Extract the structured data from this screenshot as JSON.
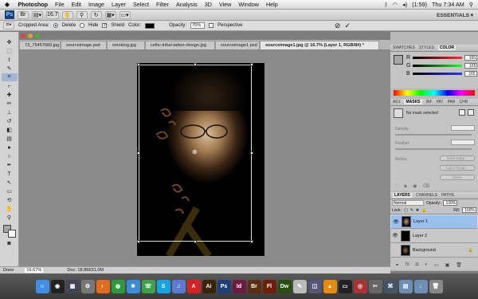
{
  "menubar": {
    "apple": "",
    "app_name": "Photoshop",
    "items": [
      "File",
      "Edit",
      "Image",
      "Layer",
      "Select",
      "Filter",
      "Analysis",
      "3D",
      "View",
      "Window",
      "Help"
    ],
    "battery": "(1:59)",
    "clock": "Thu 7:34 AM"
  },
  "appbar": {
    "ps_label": "Ps",
    "zoom": "16.7",
    "workspace": "ESSENTIALS ▾"
  },
  "options": {
    "cropped_area_label": "Cropped Area:",
    "delete_label": "Delete",
    "hide_label": "Hide",
    "shield_label": "Shield",
    "color_label": "Color:",
    "opacity_label": "Opacity:",
    "opacity_value": "75%",
    "perspective_label": "Perspective",
    "cancel_glyph": "⊘",
    "commit_glyph": "✓"
  },
  "tabs": [
    "73_75457683.jpg",
    "sourceimage.psd",
    "smoking.jpg",
    "celtic-tribal-tattoo-design.jpg",
    "sourceimage1.psd",
    "sourceimage1.jpg @ 16.7% (Layer 1, RGB/8#) *"
  ],
  "status": {
    "zoom": "16.67%",
    "doc": "Doc: 18.8M/31.0M"
  },
  "done_label": "Done",
  "panels": {
    "top_tabs": [
      "SWATCHES",
      "STYLES",
      "COLOR"
    ],
    "color_values": [
      "165",
      "165",
      "165"
    ],
    "color_labels": [
      "R",
      "G",
      "B"
    ],
    "adj_tabs": [
      "ADJ",
      "MASKS",
      "INF",
      "PAT",
      "PAR",
      "CHR"
    ],
    "masks_note": "No mask selected",
    "density_label": "Density:",
    "feather_label": "Feather:",
    "refine_label": "Refine:",
    "mask_edge": "Mask Edge...",
    "color_range": "Color Range...",
    "invert": "Invert",
    "layers_tabs": [
      "LAYERS",
      "CHANNELS",
      "PATHS"
    ],
    "blend_mode": "Normal",
    "opacity_label": "Opacity:",
    "opacity_value": "100%",
    "lock_label": "Lock:",
    "fill_label": "Fill:",
    "fill_value": "100%",
    "layers": [
      "Layer 1",
      "Layer 2",
      "Background"
    ]
  },
  "dock_icons": [
    {
      "name": "finder",
      "label": "☺",
      "color": "#3f8ee8"
    },
    {
      "name": "dashboard",
      "label": "◉",
      "color": "#222"
    },
    {
      "name": "expose",
      "label": "▦",
      "color": "#445"
    },
    {
      "name": "system-prefs",
      "label": "⚙",
      "color": "#777"
    },
    {
      "name": "firefox",
      "label": "◐",
      "color": "#e36b1e"
    },
    {
      "name": "chrome",
      "label": "◍",
      "color": "#2f9b3c"
    },
    {
      "name": "safari",
      "label": "✵",
      "color": "#3c8bd6"
    },
    {
      "name": "ichat",
      "label": "☏",
      "color": "#3da24a"
    },
    {
      "name": "skype",
      "label": "S",
      "color": "#14a3e6"
    },
    {
      "name": "itunes",
      "label": "♫",
      "color": "#5a7bd0"
    },
    {
      "name": "acrobat",
      "label": "A",
      "color": "#d62222"
    },
    {
      "name": "illustrator",
      "label": "Ai",
      "color": "#3b2200"
    },
    {
      "name": "photoshop",
      "label": "Ps",
      "color": "#1c3f7a"
    },
    {
      "name": "indesign",
      "label": "Id",
      "color": "#6d1b43"
    },
    {
      "name": "bridge",
      "label": "Br",
      "color": "#5a2f11"
    },
    {
      "name": "flash",
      "label": "Fl",
      "color": "#6e1d07"
    },
    {
      "name": "dreamweaver",
      "label": "Dw",
      "color": "#284f0d"
    },
    {
      "name": "textedit",
      "label": "✎",
      "color": "#bbb"
    },
    {
      "name": "preview",
      "label": "◫",
      "color": "#557"
    },
    {
      "name": "vlc",
      "label": "▲",
      "color": "#e88a10"
    },
    {
      "name": "terminal",
      "label": "▭",
      "color": "#222"
    },
    {
      "name": "photo-booth",
      "label": "◎",
      "color": "#a33"
    },
    {
      "name": "utility",
      "label": "✂",
      "color": "#666"
    },
    {
      "name": "network",
      "label": "⌘",
      "color": "#456"
    },
    {
      "name": "folder",
      "label": "▤",
      "color": "#6e8fb5"
    },
    {
      "name": "downloads",
      "label": "↓",
      "color": "#6e8fb5"
    },
    {
      "name": "trash",
      "label": "🗑",
      "color": "#888"
    }
  ]
}
